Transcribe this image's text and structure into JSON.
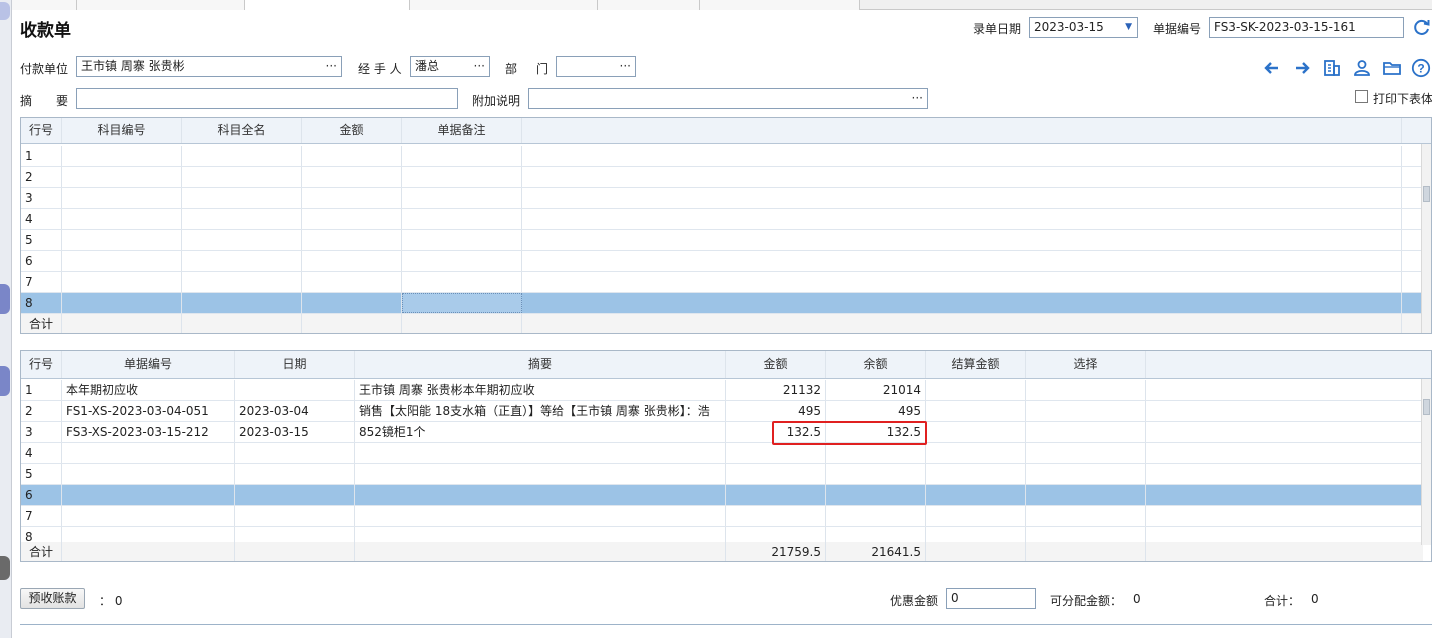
{
  "window": {
    "title": "收款单"
  },
  "header": {
    "date_label": "录单日期",
    "date_value": "2023-03-15",
    "docno_label": "单据编号",
    "docno_value": "FS3-SK-2023-03-15-161",
    "payer_label": "付款单位",
    "payer_value": "王市镇 周寨 张贵彬",
    "handler_label": "经 手 人",
    "handler_value": "潘总",
    "dept_label_1": "部",
    "dept_label_2": "门",
    "dept_value": "",
    "summary_label_1": "摘",
    "summary_label_2": "要",
    "summary_value": "",
    "extra_label": "附加说明",
    "extra_value": "",
    "print_label": "打印下表体",
    "print_checked": false
  },
  "toolbar_icons": [
    "arrow-left-icon",
    "arrow-right-icon",
    "document-icon",
    "person-icon",
    "folder-icon",
    "help-icon"
  ],
  "accent_color": "#2b72c9",
  "grid1": {
    "columns": [
      "行号",
      "科目编号",
      "科目全名",
      "金额",
      "单据备注"
    ],
    "rows": [
      {
        "no": "1"
      },
      {
        "no": "2"
      },
      {
        "no": "3"
      },
      {
        "no": "4"
      },
      {
        "no": "5"
      },
      {
        "no": "6"
      },
      {
        "no": "7"
      },
      {
        "no": "8"
      }
    ],
    "selected_row": 8,
    "total_label": "合计"
  },
  "grid2": {
    "columns": [
      "行号",
      "单据编号",
      "日期",
      "摘要",
      "金额",
      "余额",
      "结算金额",
      "选择"
    ],
    "rows": [
      {
        "no": "1",
        "docno": "本年期初应收",
        "date": "",
        "summary": "王市镇 周寨 张贵彬本年期初应收",
        "amount": "21132",
        "balance": "21014",
        "settle": "",
        "select": ""
      },
      {
        "no": "2",
        "docno": "FS1-XS-2023-03-04-051",
        "date": "2023-03-04",
        "summary": "销售【太阳能 18支水箱（正直）】等给【王市镇 周寨 张贵彬】：浩",
        "amount": "495",
        "balance": "495",
        "settle": "",
        "select": ""
      },
      {
        "no": "3",
        "docno": "FS3-XS-2023-03-15-212",
        "date": "2023-03-15",
        "summary": "852镜柜1个",
        "amount": "132.5",
        "balance": "132.5",
        "settle": "",
        "select": ""
      },
      {
        "no": "4",
        "docno": "",
        "date": "",
        "summary": "",
        "amount": "",
        "balance": "",
        "settle": "",
        "select": ""
      },
      {
        "no": "5",
        "docno": "",
        "date": "",
        "summary": "",
        "amount": "",
        "balance": "",
        "settle": "",
        "select": ""
      },
      {
        "no": "6",
        "docno": "",
        "date": "",
        "summary": "",
        "amount": "",
        "balance": "",
        "settle": "",
        "select": ""
      },
      {
        "no": "7",
        "docno": "",
        "date": "",
        "summary": "",
        "amount": "",
        "balance": "",
        "settle": "",
        "select": ""
      },
      {
        "no": "8",
        "docno": "",
        "date": "",
        "summary": "",
        "amount": "",
        "balance": "",
        "settle": "",
        "select": ""
      }
    ],
    "selected_row": 6,
    "total_label": "合计",
    "total_amount": "21759.5",
    "total_balance": "21641.5"
  },
  "footer": {
    "prepay_button": "预收账款",
    "prepay_value": "：  0",
    "discount_label": "优惠金额",
    "discount_value": "0",
    "allocatable_label": "可分配金额：",
    "allocatable_value": "0",
    "sum_label": "合计：",
    "sum_value": "0"
  }
}
